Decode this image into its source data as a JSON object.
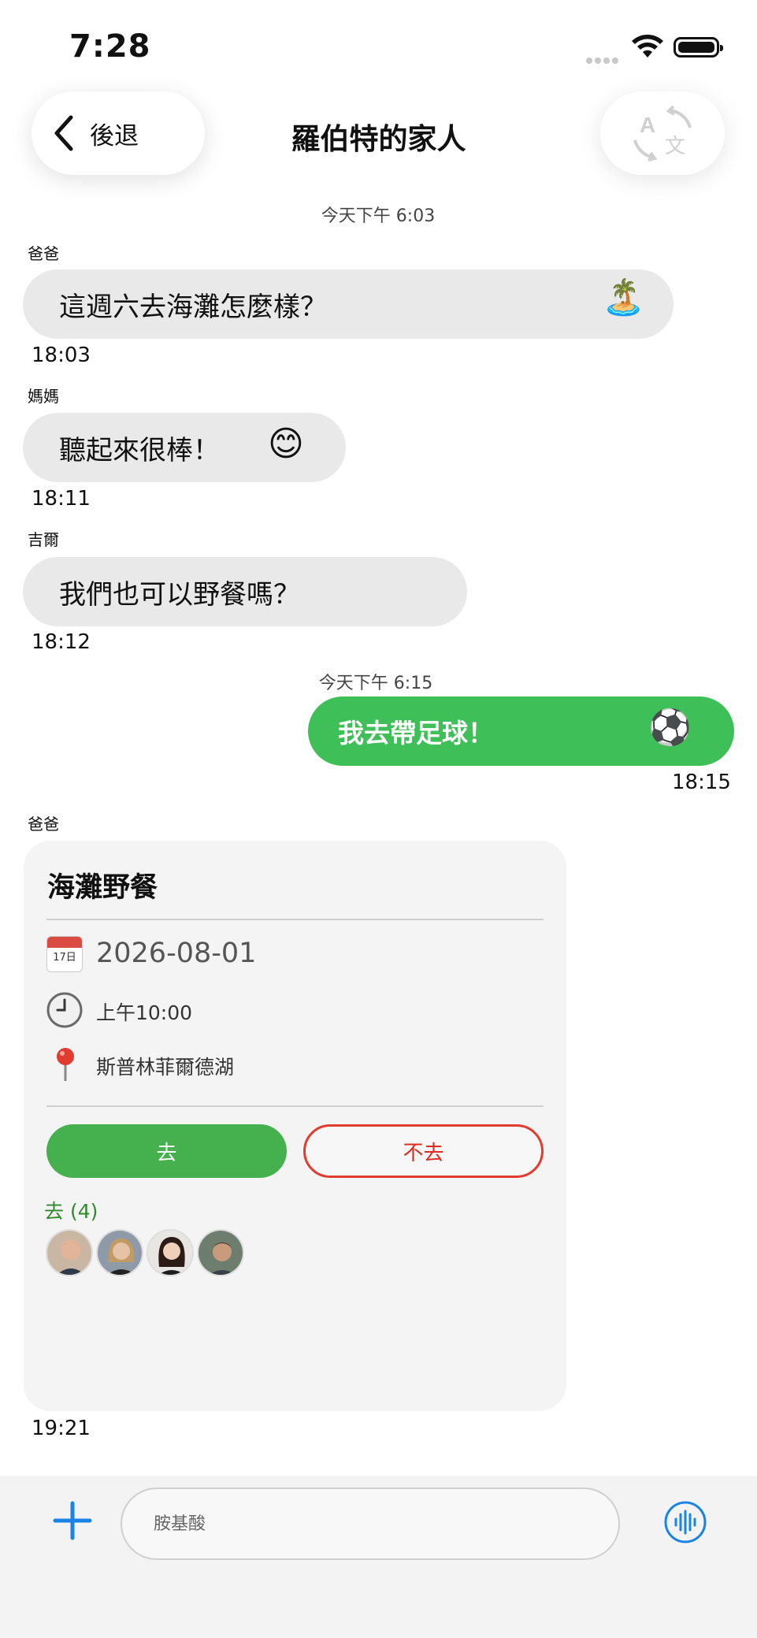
{
  "status_bar": {
    "time": "7:28"
  },
  "nav": {
    "back_label": "後退",
    "title": "羅伯特的家人",
    "translate_icon": "translate-icon"
  },
  "messages": [
    {
      "timestamp": "今天下午 6:03",
      "sender": "爸爸",
      "text": "這週六去海灘怎麼樣？",
      "emoji": "🏝️",
      "time": "18:03"
    },
    {
      "sender": "媽媽",
      "text": "聽起來很棒！",
      "emoji": "😊",
      "time": "18:11"
    },
    {
      "sender": "吉爾",
      "text": "我們也可以野餐嗎？",
      "time": "18:12"
    },
    {
      "timestamp": "今天下午 6:15",
      "text": "我去帶足球！",
      "emoji": "⚽",
      "time": "18:15"
    }
  ],
  "event": {
    "sender": "爸爸",
    "title": "海灘野餐",
    "date": "2026-08-01",
    "calendar_icon_text": "17日",
    "time": "上午10:00",
    "location": "斯普林菲爾德湖",
    "go_label": "去",
    "not_go_label": "不去",
    "going_label": "去 (4)",
    "attendees": [
      "attendee-1",
      "attendee-2",
      "attendee-3",
      "attendee-4"
    ],
    "sent_time": "19:21"
  },
  "composer": {
    "placeholder": "胺基酸"
  },
  "colors": {
    "outgoing": "#3fbf57",
    "go_button": "#44b04e",
    "not_go_border": "#e23b2f",
    "accent_blue": "#1a84e6"
  }
}
